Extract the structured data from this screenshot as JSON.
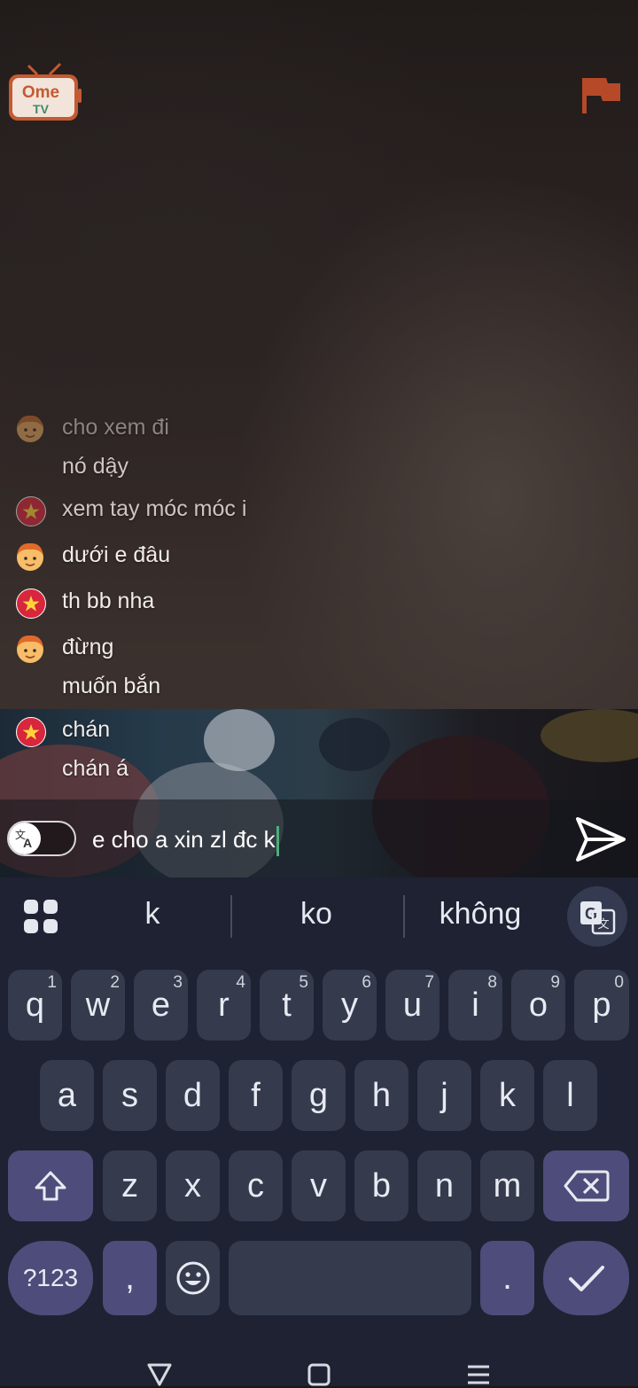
{
  "app": {
    "logo_top": "Ome",
    "logo_bottom": "TV"
  },
  "chat": {
    "messages": [
      {
        "text": "cho xem đi",
        "sender": "avatar",
        "style": "faded"
      },
      {
        "text": "nó dậy",
        "sender": "avatar",
        "style": "semi"
      },
      {
        "text": "xem tay móc móc i",
        "sender": "vn-flag",
        "style": "semi"
      },
      {
        "text": "dưới e đâu",
        "sender": "avatar",
        "style": "normal"
      },
      {
        "text": "th bb nha",
        "sender": "vn-flag",
        "style": "normal"
      },
      {
        "text": "đừng",
        "sender": "avatar",
        "style": "normal"
      },
      {
        "text": "muốn bắn",
        "sender": "avatar",
        "style": "normal"
      },
      {
        "text": "chán",
        "sender": "vn-flag",
        "style": "normal"
      },
      {
        "text": "chán á",
        "sender": "vn-flag",
        "style": "normal"
      }
    ]
  },
  "input": {
    "value": "e cho a xin zl đc k",
    "translate_on": false
  },
  "keyboard": {
    "suggestions": [
      "k",
      "ko",
      "không"
    ],
    "row1": [
      {
        "key": "q",
        "hint": "1"
      },
      {
        "key": "w",
        "hint": "2"
      },
      {
        "key": "e",
        "hint": "3"
      },
      {
        "key": "r",
        "hint": "4"
      },
      {
        "key": "t",
        "hint": "5"
      },
      {
        "key": "y",
        "hint": "6"
      },
      {
        "key": "u",
        "hint": "7"
      },
      {
        "key": "i",
        "hint": "8"
      },
      {
        "key": "o",
        "hint": "9"
      },
      {
        "key": "p",
        "hint": "0"
      }
    ],
    "row2": [
      "a",
      "s",
      "d",
      "f",
      "g",
      "h",
      "j",
      "k",
      "l"
    ],
    "row3": [
      "z",
      "x",
      "c",
      "v",
      "b",
      "n",
      "m"
    ],
    "symbols_label": "?123",
    "comma_label": ",",
    "period_label": "."
  },
  "colors": {
    "accent_caret": "#4caf79",
    "flag_red": "#d7263d",
    "logo_orange": "#c45a32"
  },
  "icons": {
    "report": "flag-icon",
    "send": "send-icon",
    "translate": "translate-icon",
    "apps": "apps-grid-icon",
    "shift": "shift-icon",
    "backspace": "backspace-icon",
    "emoji": "emoji-icon",
    "enter": "check-icon",
    "nav_back": "nav-back-icon",
    "nav_home": "nav-home-icon",
    "nav_recents": "nav-recents-icon"
  }
}
